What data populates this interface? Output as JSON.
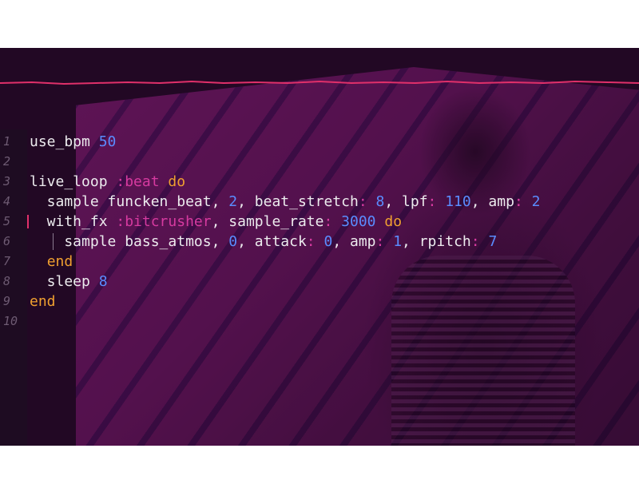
{
  "colors": {
    "keyword": "#f0a030",
    "symbol": "#d63aa0",
    "number": "#5a8cff",
    "text": "#ecebee",
    "line_number": "#6d5a72",
    "scope_line": "#e0306a"
  },
  "editor": {
    "line_numbers": [
      "1",
      "2",
      "3",
      "4",
      "5",
      "6",
      "7",
      "8",
      "9",
      "10"
    ],
    "lines": [
      [
        {
          "t": "use_bpm ",
          "c": "plain"
        },
        {
          "t": "50",
          "c": "num"
        }
      ],
      [],
      [
        {
          "t": "live_loop ",
          "c": "plain"
        },
        {
          "t": ":beat",
          "c": "sym"
        },
        {
          "t": " ",
          "c": "plain"
        },
        {
          "t": "do",
          "c": "kw"
        }
      ],
      [
        {
          "t": "  sample funcken_beat, ",
          "c": "plain"
        },
        {
          "t": "2",
          "c": "num"
        },
        {
          "t": ", beat_stretch",
          "c": "plain"
        },
        {
          "t": ":",
          "c": "key"
        },
        {
          "t": " ",
          "c": "plain"
        },
        {
          "t": "8",
          "c": "num"
        },
        {
          "t": ", lpf",
          "c": "plain"
        },
        {
          "t": ":",
          "c": "key"
        },
        {
          "t": " ",
          "c": "plain"
        },
        {
          "t": "110",
          "c": "num"
        },
        {
          "t": ", amp",
          "c": "plain"
        },
        {
          "t": ":",
          "c": "key"
        },
        {
          "t": " ",
          "c": "plain"
        },
        {
          "t": "2",
          "c": "num"
        }
      ],
      [
        {
          "t": "  with_fx ",
          "c": "plain"
        },
        {
          "t": ":bitcrusher",
          "c": "sym"
        },
        {
          "t": ", sample_rate",
          "c": "plain"
        },
        {
          "t": ":",
          "c": "key"
        },
        {
          "t": " ",
          "c": "plain"
        },
        {
          "t": "3000",
          "c": "num"
        },
        {
          "t": " ",
          "c": "plain"
        },
        {
          "t": "do",
          "c": "kw"
        }
      ],
      [
        {
          "t": "    sample bass_atmos, ",
          "c": "plain"
        },
        {
          "t": "0",
          "c": "num"
        },
        {
          "t": ", attack",
          "c": "plain"
        },
        {
          "t": ":",
          "c": "key"
        },
        {
          "t": " ",
          "c": "plain"
        },
        {
          "t": "0",
          "c": "num"
        },
        {
          "t": ", amp",
          "c": "plain"
        },
        {
          "t": ":",
          "c": "key"
        },
        {
          "t": " ",
          "c": "plain"
        },
        {
          "t": "1",
          "c": "num"
        },
        {
          "t": ", rpitch",
          "c": "plain"
        },
        {
          "t": ":",
          "c": "key"
        },
        {
          "t": " ",
          "c": "plain"
        },
        {
          "t": "7",
          "c": "num"
        }
      ],
      [
        {
          "t": "  ",
          "c": "plain"
        },
        {
          "t": "end",
          "c": "kw"
        }
      ],
      [
        {
          "t": "  sleep ",
          "c": "plain"
        },
        {
          "t": "8",
          "c": "num"
        }
      ],
      [
        {
          "t": "end",
          "c": "kw"
        }
      ],
      []
    ]
  }
}
